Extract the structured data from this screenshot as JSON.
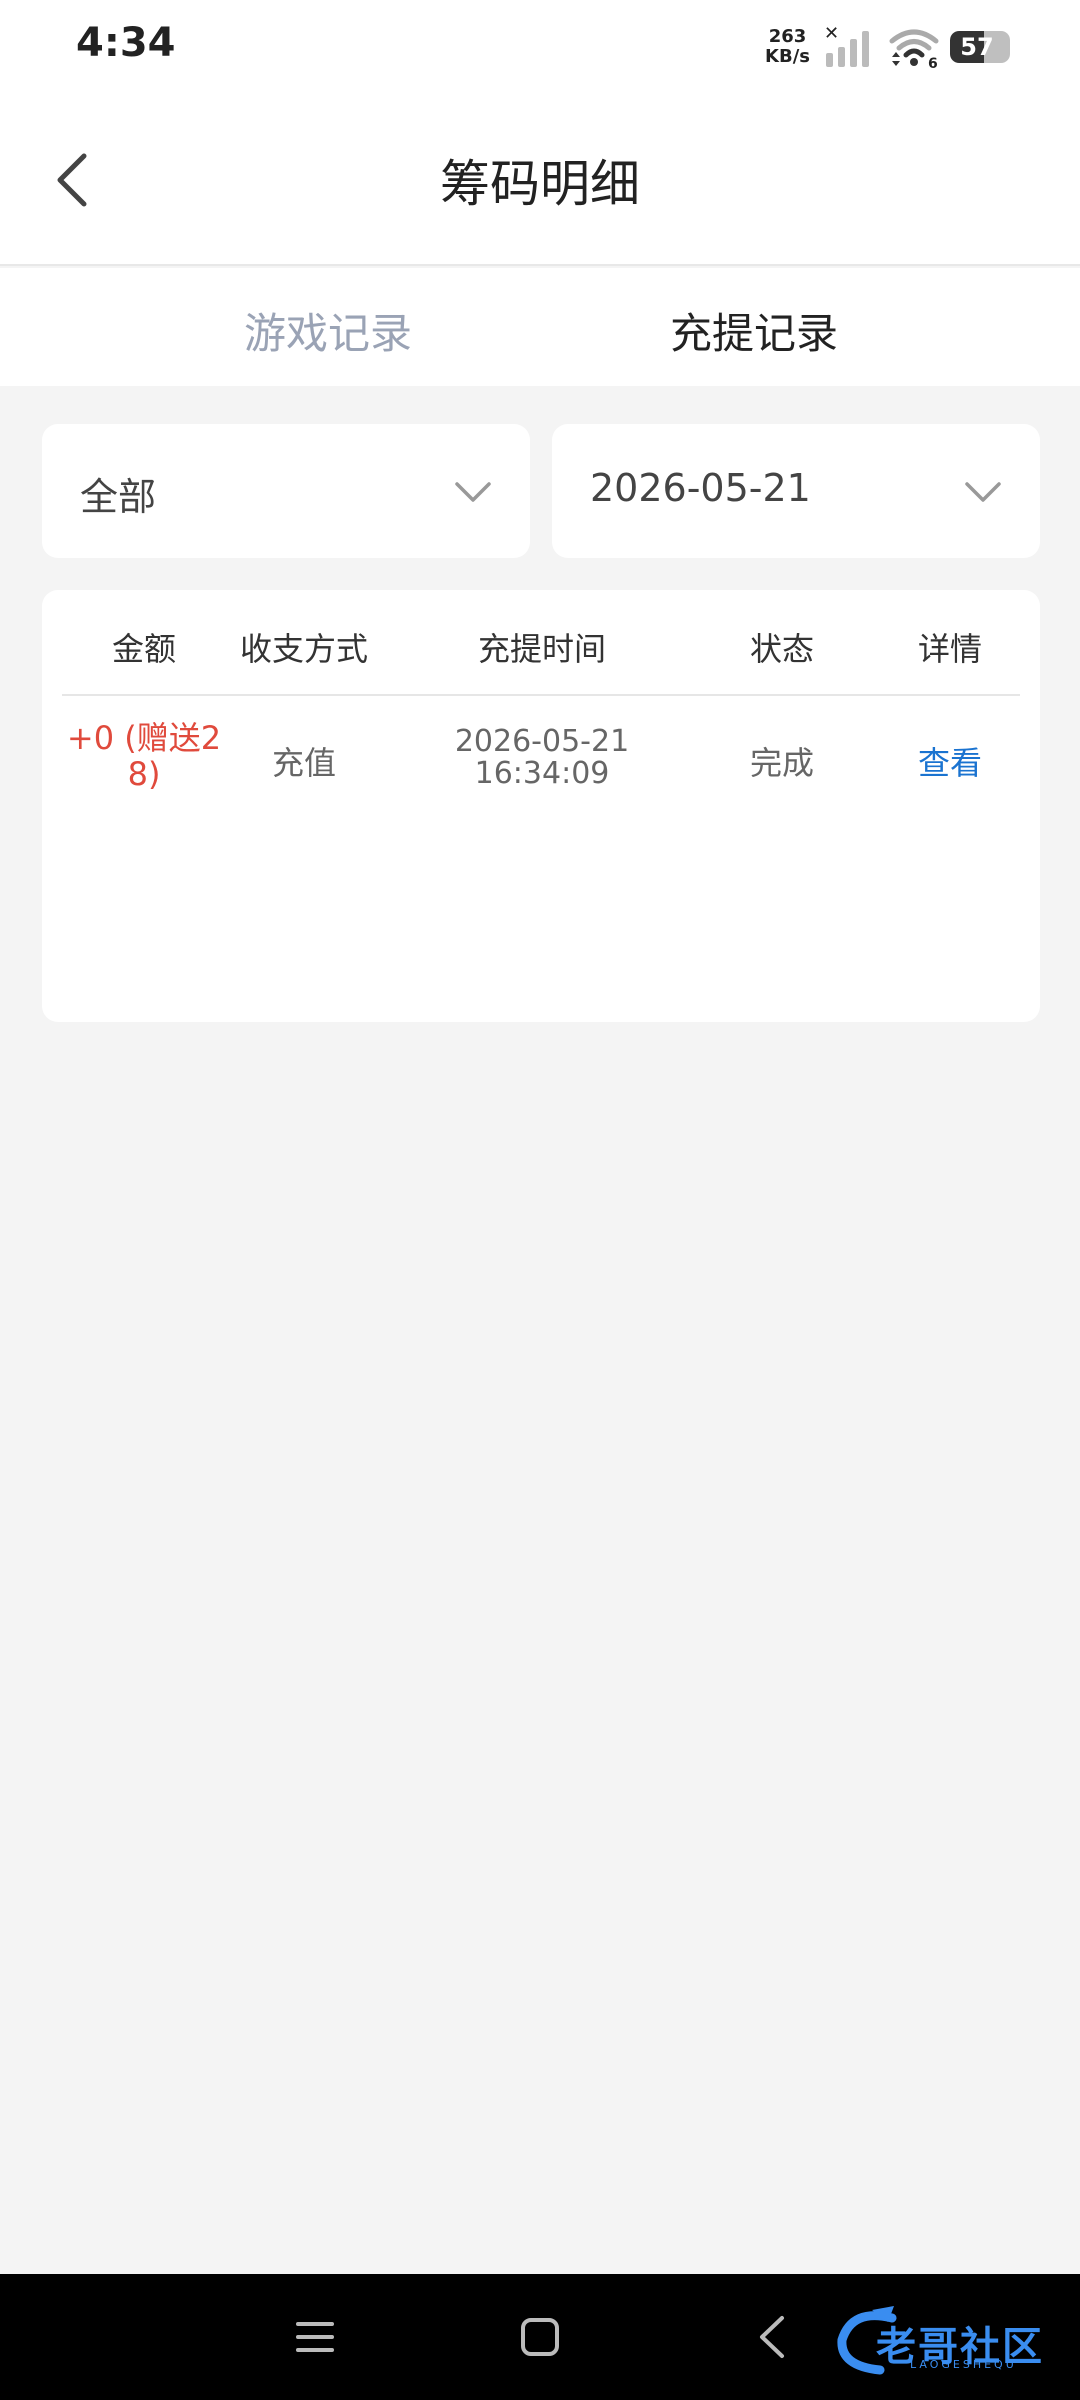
{
  "status_bar": {
    "time": "4:34",
    "net_speed_value": "263",
    "net_speed_unit": "KB/s",
    "wifi_label": "6",
    "battery_level": 57,
    "battery_text": "57"
  },
  "header": {
    "title": "筹码明细"
  },
  "tabs": [
    {
      "label": "游戏记录",
      "active": false
    },
    {
      "label": "充提记录",
      "active": true
    }
  ],
  "filters": {
    "type_value": "全部",
    "date_value": "2026-05-21"
  },
  "table": {
    "headers": [
      "金额",
      "收支方式",
      "充提时间",
      "状态",
      "详情"
    ],
    "rows": [
      {
        "amount_line1": "+0 (赠送2",
        "amount_line2": "8)",
        "method": "充值",
        "date": "2026-05-21",
        "time": "16:34:09",
        "status": "完成",
        "detail_link": "查看"
      }
    ]
  },
  "watermark": {
    "text": "老哥社区",
    "sub": "LAOGESHEQU"
  },
  "colors": {
    "amount": "#e04a3c",
    "link": "#1a73d0",
    "tab_inactive": "#9aa3b5",
    "background": "#f4f4f4"
  }
}
